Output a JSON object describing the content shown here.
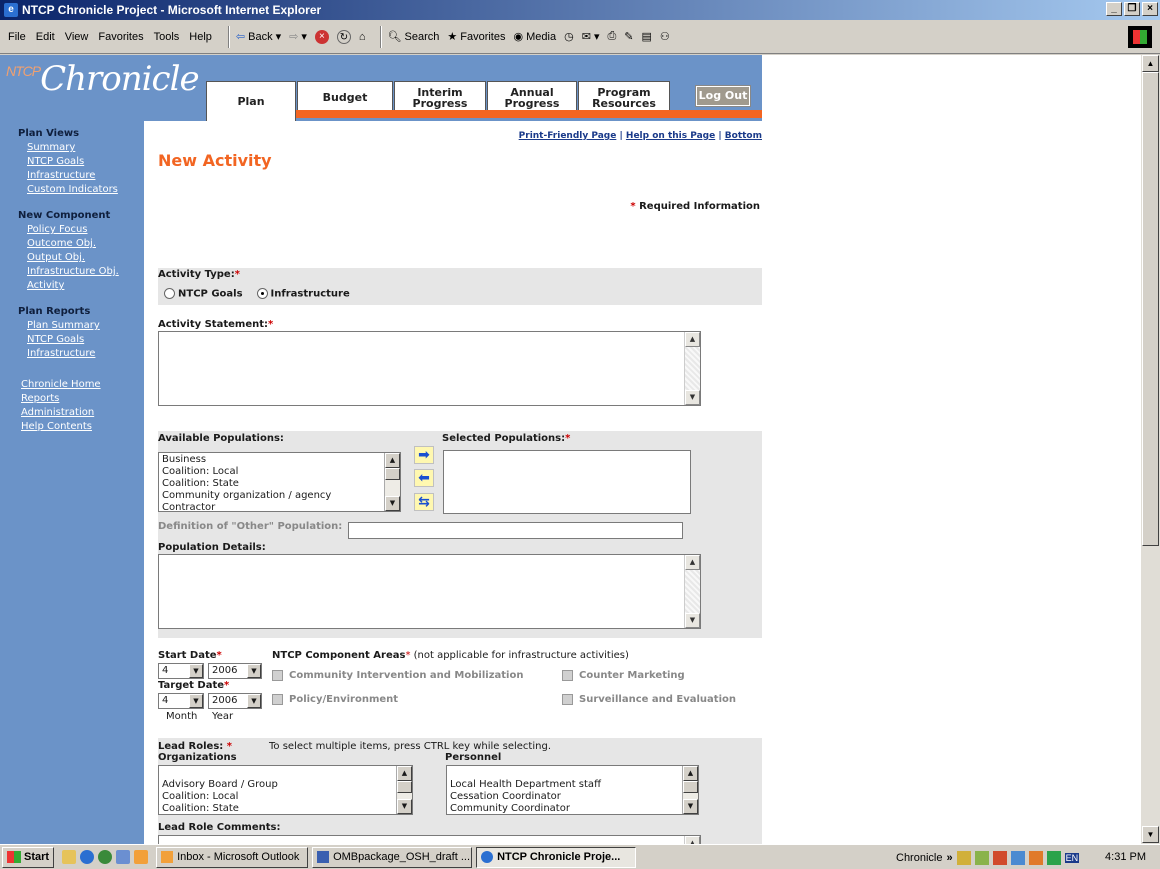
{
  "window": {
    "title": "NTCP Chronicle Project - Microsoft Internet Explorer"
  },
  "menu": [
    "File",
    "Edit",
    "View",
    "Favorites",
    "Tools",
    "Help"
  ],
  "toolbar": {
    "back": "Back",
    "search": "Search",
    "favorites": "Favorites",
    "media": "Media"
  },
  "header": {
    "logo_ntcp": "NTCP",
    "logo_text": "Chronicle",
    "tabs": {
      "plan": "Plan",
      "budget": "Budget",
      "interim_1": "Interim",
      "interim_2": "Progress",
      "annual_1": "Annual",
      "annual_2": "Progress",
      "program_1": "Program",
      "program_2": "Resources"
    },
    "logout": "Log Out",
    "accent_color": "#f26522",
    "brand_color": "#6b93c8"
  },
  "sidebar": {
    "plan_views": {
      "heading": "Plan Views",
      "items": [
        "Summary",
        "NTCP Goals",
        "Infrastructure",
        "Custom Indicators"
      ]
    },
    "new_component": {
      "heading": "New Component",
      "items": [
        "Policy Focus",
        "Outcome Obj.",
        "Output Obj.",
        "Infrastructure Obj.",
        "Activity"
      ]
    },
    "plan_reports": {
      "heading": "Plan Reports",
      "items": [
        "Plan Summary",
        "NTCP Goals",
        "Infrastructure"
      ]
    },
    "links": [
      "Chronicle Home",
      "Reports",
      "Administration",
      "Help Contents"
    ]
  },
  "main": {
    "toplinks": {
      "print": "Print-Friendly Page",
      "help": "Help on this Page",
      "bottom": "Bottom",
      "sep": "|"
    },
    "title": "New Activity",
    "required_note": "Required Information",
    "asterisk": "*",
    "activity_type": {
      "label": "Activity Type:",
      "options": [
        "NTCP Goals",
        "Infrastructure"
      ],
      "selected": "Infrastructure"
    },
    "activity_statement": {
      "label": "Activity Statement:",
      "value": ""
    },
    "populations": {
      "available_label": "Available Populations:",
      "selected_label": "Selected Populations:",
      "available": [
        "Business",
        "Coalition: Local",
        "Coalition: State",
        "Community organization / agency",
        "Contractor"
      ],
      "selected": []
    },
    "other_population": {
      "label": "Definition of \"Other\" Population:",
      "value": ""
    },
    "population_details": {
      "label": "Population Details:",
      "value": ""
    },
    "dates": {
      "start_label": "Start Date",
      "target_label": "Target Date",
      "start_month": "4",
      "start_year": "2006",
      "target_month": "4",
      "target_year": "2006",
      "month_label": "Month",
      "year_label": "Year"
    },
    "component_areas": {
      "label": "NTCP Component Areas",
      "note": "(not applicable for infrastructure activities)",
      "options": [
        "Community Intervention and Mobilization",
        "Counter Marketing",
        "Policy/Environment",
        "Surveillance and Evaluation"
      ]
    },
    "lead_roles": {
      "label": "Lead Roles:",
      "hint": "To select multiple items, press CTRL key while selecting.",
      "organizations_label": "Organizations",
      "personnel_label": "Personnel",
      "organizations": [
        "",
        "Advisory Board / Group",
        "Coalition: Local",
        "Coalition: State"
      ],
      "personnel": [
        "",
        "Local Health Department staff",
        "Cessation Coordinator",
        "Community Coordinator"
      ]
    },
    "lead_role_comments": {
      "label": "Lead Role Comments:",
      "value": ""
    }
  },
  "taskbar": {
    "start": "Start",
    "tasks": [
      "Inbox - Microsoft Outlook",
      "OMBpackage_OSH_draft ...",
      "NTCP Chronicle Proje..."
    ],
    "chronicle": "Chronicle",
    "chevron": "»",
    "lang": "EN",
    "time": "4:31 PM"
  }
}
